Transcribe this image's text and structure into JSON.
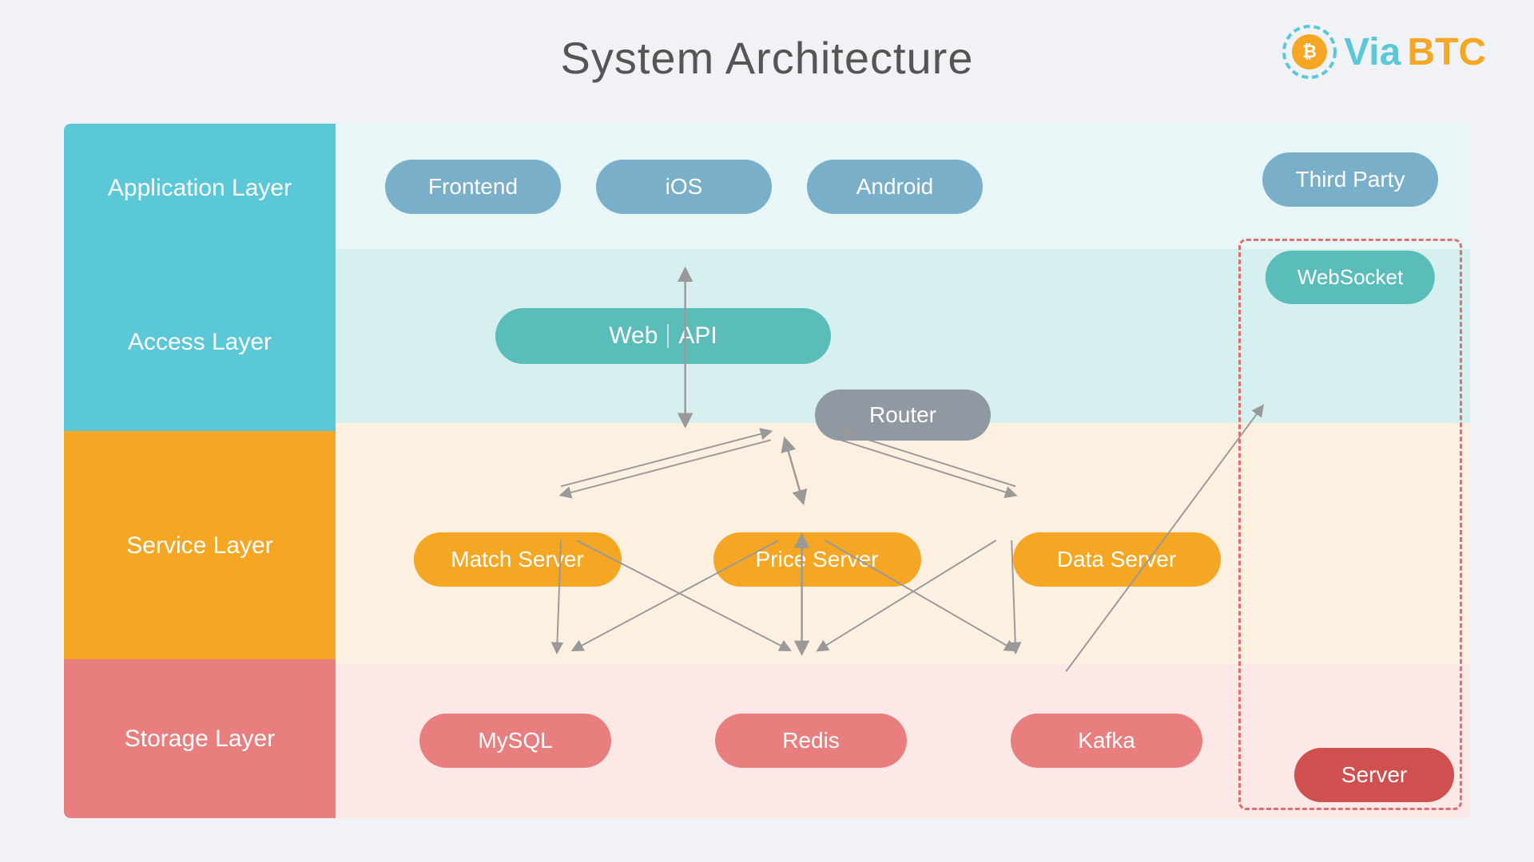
{
  "title": "System Architecture",
  "logo": {
    "via": "Via",
    "btc": "BTC"
  },
  "layers": {
    "application": "Application Layer",
    "access": "Access Layer",
    "service": "Service Layer",
    "storage": "Storage Layer"
  },
  "app_items": [
    "Frontend",
    "iOS",
    "Android",
    "Third Party"
  ],
  "access_items": {
    "web_api": "Web  |  API",
    "websocket": "WebSocket"
  },
  "service_items": {
    "router": "Router",
    "match": "Match Server",
    "price": "Price Server",
    "data": "Data Server"
  },
  "storage_items": [
    "MySQL",
    "Redis",
    "Kafka"
  ],
  "server": "Server"
}
